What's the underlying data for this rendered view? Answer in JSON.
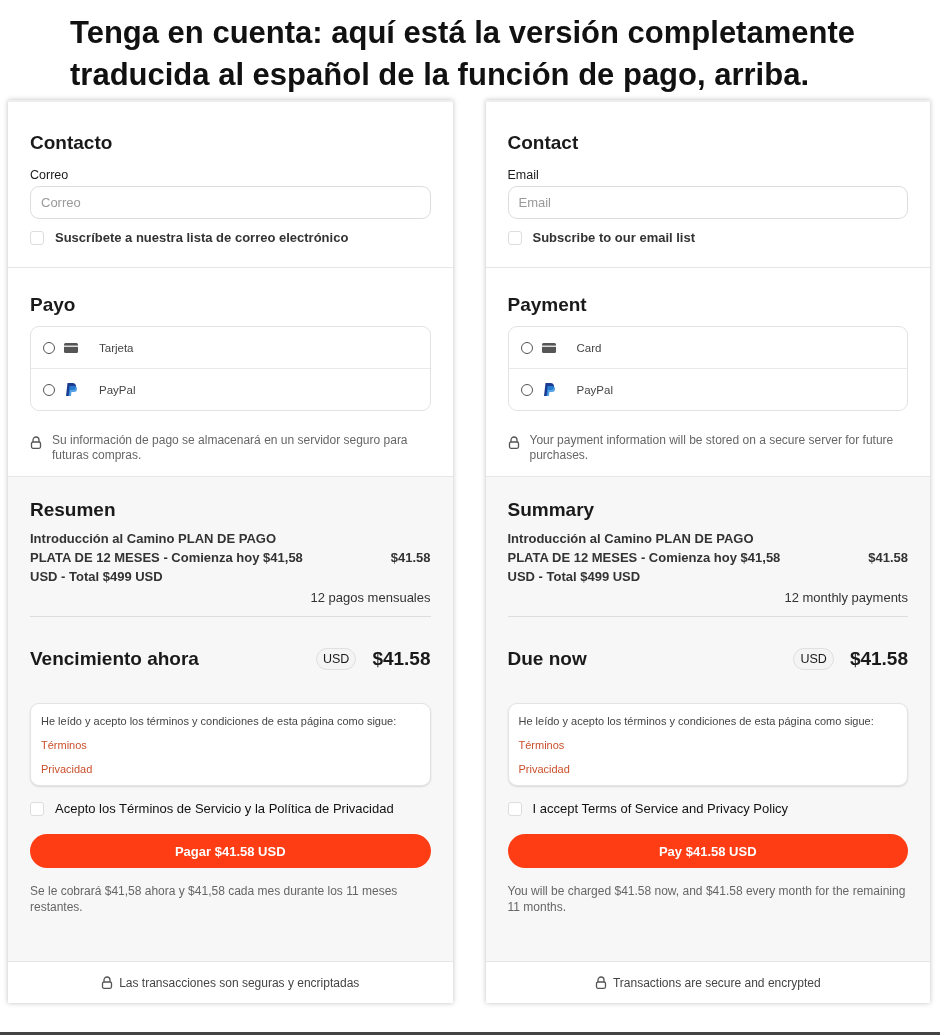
{
  "caption": "Tenga en cuenta: aquí está la versión completamente traducida al español de la función de pago, arriba.",
  "panels": [
    {
      "contact": {
        "heading": "Contacto",
        "email_label": "Correo",
        "email_placeholder": "Correo",
        "subscribe": {
          "label": "Suscríbete a nuestra lista de correo electrónico",
          "checked": false
        }
      },
      "payment": {
        "heading": "Payo",
        "options": [
          {
            "kind": "card",
            "label": "Tarjeta",
            "selected": false
          },
          {
            "kind": "paypal",
            "label": "PayPal",
            "selected": false
          }
        ],
        "note": "Su información de pago se almacenará en un servidor seguro para futuras compras."
      },
      "summary": {
        "heading": "Resumen",
        "item": "Introducción al Camino PLAN DE PAGO PLATA DE 12 MESES - Comienza hoy $41,58 USD - Total $499 USD",
        "item_price": "$41.58",
        "schedule": "12 pagos mensuales",
        "due_label": "Vencimiento ahora",
        "currency": "USD",
        "due_amount": "$41.58"
      },
      "terms": {
        "intro": "He leído y acepto los términos y condiciones de esta página como sigue:",
        "links": [
          "Términos",
          "Privacidad"
        ],
        "accept": {
          "label": "Acepto los Términos de Servicio y la Política de Privacidad",
          "checked": false
        }
      },
      "pay_button": "Pagar $41.58 USD",
      "charge_note": "Se le cobrará $41,58 ahora y $41,58 cada mes durante los 11 meses restantes.",
      "footer": "Las transacciones son seguras y encriptadas"
    },
    {
      "contact": {
        "heading": "Contact",
        "email_label": "Email",
        "email_placeholder": "Email",
        "subscribe": {
          "label": "Subscribe to our email list",
          "checked": false
        }
      },
      "payment": {
        "heading": "Payment",
        "options": [
          {
            "kind": "card",
            "label": "Card",
            "selected": false
          },
          {
            "kind": "paypal",
            "label": "PayPal",
            "selected": false
          }
        ],
        "note": "Your payment information will be stored on a secure server for future purchases."
      },
      "summary": {
        "heading": "Summary",
        "item": "Introducción al Camino PLAN DE PAGO PLATA DE 12 MESES - Comienza hoy $41,58 USD - Total $499 USD",
        "item_price": "$41.58",
        "schedule": "12 monthly payments",
        "due_label": "Due now",
        "currency": "USD",
        "due_amount": "$41.58"
      },
      "terms": {
        "intro": "He leído y acepto los términos y condiciones de esta página como sigue:",
        "links": [
          "Términos",
          "Privacidad"
        ],
        "accept": {
          "label": "I accept Terms of Service and Privacy Policy",
          "checked": false
        }
      },
      "pay_button": "Pay $41.58 USD",
      "charge_note": "You will be charged $41.58 now, and $41.58 every month for the remaining 11 months.",
      "footer": "Transactions are secure and encrypted"
    }
  ]
}
